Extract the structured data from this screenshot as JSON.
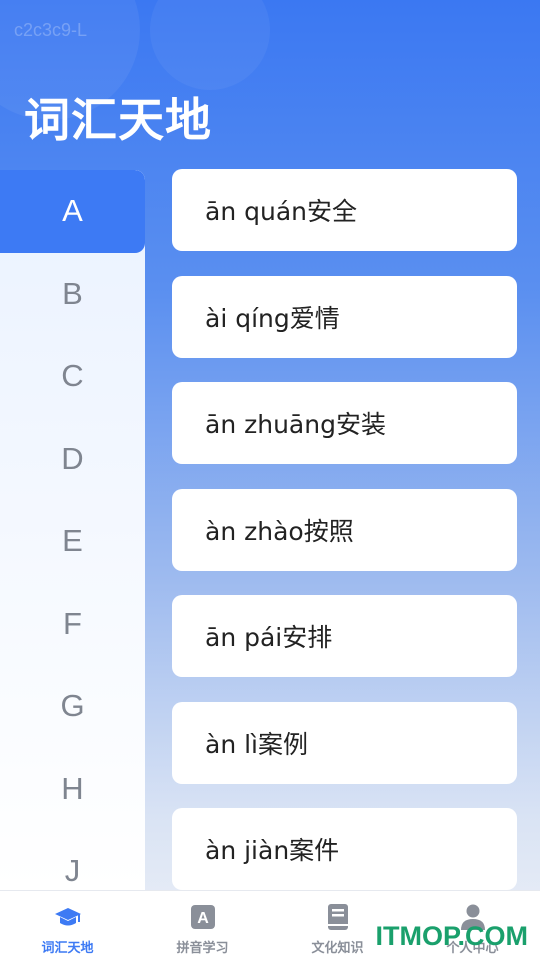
{
  "watermark": "c2c3c9-L",
  "header": {
    "title": "词汇天地"
  },
  "sidebar": {
    "letters": [
      "A",
      "B",
      "C",
      "D",
      "E",
      "F",
      "G",
      "H",
      "J"
    ],
    "active": "A"
  },
  "words": [
    "ān quán安全",
    "ài qíng爱情",
    "ān zhuāng安装",
    "àn zhào按照",
    "ān pái安排",
    "àn lì案例",
    "àn jiàn案件"
  ],
  "tabbar": {
    "tabs": [
      {
        "label": "词汇天地",
        "icon": "graduation-cap-icon",
        "active": true
      },
      {
        "label": "拼音学习",
        "icon": "letter-a-icon",
        "active": false
      },
      {
        "label": "文化知识",
        "icon": "book-icon",
        "active": false
      },
      {
        "label": "个人中心",
        "icon": "person-icon",
        "active": false
      }
    ]
  },
  "site_mark": "ITMOP.COM",
  "colors": {
    "accent": "#3d7af4",
    "inactive": "#8a8f99",
    "site_mark": "#1aa06c"
  }
}
